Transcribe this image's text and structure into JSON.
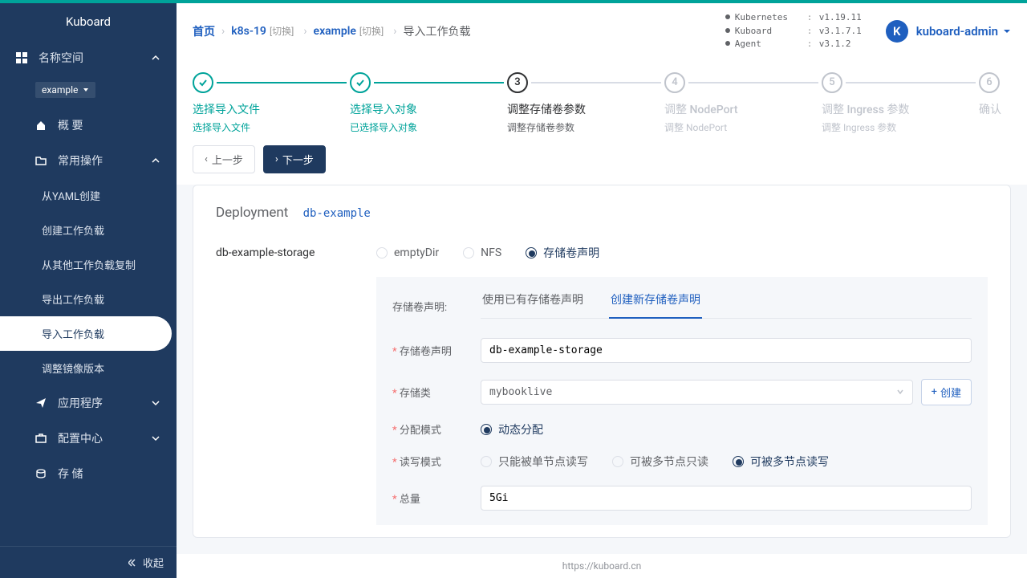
{
  "app_name": "Kuboard",
  "sidebar": {
    "namespace_section": "名称空间",
    "namespace": "example",
    "overview": "概 要",
    "common_ops": "常用操作",
    "items": [
      "从YAML创建",
      "创建工作负载",
      "从其他工作负载复制",
      "导出工作负载",
      "导入工作负载",
      "调整镜像版本"
    ],
    "applications": "应用程序",
    "config_center": "配置中心",
    "storage": "存 储",
    "collapse": "收起"
  },
  "breadcrumb": {
    "home": "首页",
    "cluster": "k8s-19",
    "switch": "[切换]",
    "ns": "example",
    "current": "导入工作负载"
  },
  "versions": [
    {
      "k": "Kubernetes",
      "v": "v1.19.11"
    },
    {
      "k": "Kuboard",
      "v": "v3.1.7.1"
    },
    {
      "k": "Agent",
      "v": "v3.1.2"
    }
  ],
  "profile": {
    "initial": "K",
    "name": "kuboard-admin"
  },
  "steps": [
    {
      "title": "选择导入文件",
      "desc": "选择导入文件"
    },
    {
      "title": "选择导入对象",
      "desc": "已选择导入对象"
    },
    {
      "title": "调整存储卷参数",
      "desc": "调整存储卷参数"
    },
    {
      "title": "调整 NodePort",
      "desc": "调整 NodePort"
    },
    {
      "title": "调整 Ingress 参数",
      "desc": "调整 Ingress 参数"
    },
    {
      "title": "确认",
      "desc": ""
    }
  ],
  "nav": {
    "prev": "上一步",
    "next": "下一步"
  },
  "panel": {
    "type_label": "Deployment",
    "name": "db-example",
    "vol_name": "db-example-storage",
    "vol_types": [
      "emptyDir",
      "NFS",
      "存储卷声明"
    ],
    "pvc_label": "存储卷声明:",
    "tabs": [
      "使用已有存储卷声明",
      "创建新存储卷声明"
    ],
    "fields": {
      "pvc_name": {
        "label": "存储卷声明",
        "value": "db-example-storage"
      },
      "storage_class": {
        "label": "存储类",
        "value": "mybooklive",
        "create": "创建"
      },
      "alloc_mode": {
        "label": "分配模式",
        "options": [
          "动态分配"
        ]
      },
      "access_mode": {
        "label": "读写模式",
        "options": [
          "只能被单节点读写",
          "可被多节点只读",
          "可被多节点读写"
        ]
      },
      "total": {
        "label": "总量",
        "value": "5Gi"
      }
    }
  },
  "footer": "https://kuboard.cn"
}
